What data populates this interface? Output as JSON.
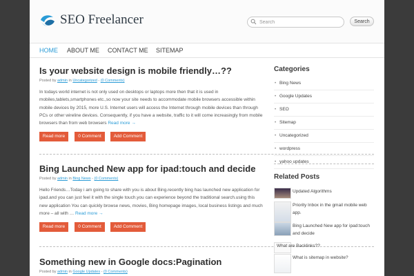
{
  "header": {
    "site_title": "SEO Freelancer",
    "search_placeholder": "Search",
    "search_button": "Search"
  },
  "nav": [
    "HOME",
    "ABOUT ME",
    "CONTACT ME",
    "SITEMAP"
  ],
  "posts": [
    {
      "title": "Is your website design is mobile friendly…??",
      "posted_by": "Posted by",
      "author": "admin",
      "in": "in",
      "category": "Uncategorized",
      "comments": "(0 Comments)",
      "excerpt": "In todays world internet is not only used on desktops or laptops more then that it is used in mobiles,tablets,smartphones etc.,so now your site needs to accommodate mobile browsers accessible within mobile devices by 2015, more U.S. Internet users will access the Internet through mobile devices than through PCs or other wireline devices. Consequently, if you have a website, traffic to it will come increasingly from mobile browsers than from web browsers",
      "read_more": "Read more →"
    },
    {
      "title": "Bing Launched New app for ipad:touch and decide",
      "posted_by": "Posted by",
      "author": "admin",
      "in": "in",
      "category": "Bing News",
      "comments": "(0 Comments)",
      "excerpt": "Hello Friends…Today i am going to share with you is about Bing.recently bing has launched new application for ipad.and you can just feel it with the single touch.you can experience beyond the traditional search.using this new application You can quickly browse news, movies, Bing homepage images, local business listings and much more – all with …",
      "read_more": "Read more →"
    },
    {
      "title": "Something new in Google docs:Pagination",
      "posted_by": "Posted by",
      "author": "admin",
      "in": "in",
      "category": "Google Updates",
      "comments": "(0 Comments)"
    }
  ],
  "post_buttons": {
    "read_more": "Read more",
    "comment": "0 Comment",
    "add_comment": "Add Comment"
  },
  "sidebar": {
    "categories_title": "Categories",
    "categories": [
      "Bing News",
      "Google Updates",
      "SEO",
      "Sitemap",
      "Uncategorized",
      "wordpress",
      "yahoo updates"
    ],
    "related_title": "Related Posts",
    "related": [
      "Updated Algorithms",
      "Priority Inbox in the gmail mobile web app.",
      "Bing Launched New app for ipad:touch and decide",
      "What are Backlinks??",
      "What is sitemap in website?"
    ]
  },
  "colors": {
    "accent": "#2a9bd6",
    "button": "#e35b3a",
    "background": "#3b3b3b"
  }
}
